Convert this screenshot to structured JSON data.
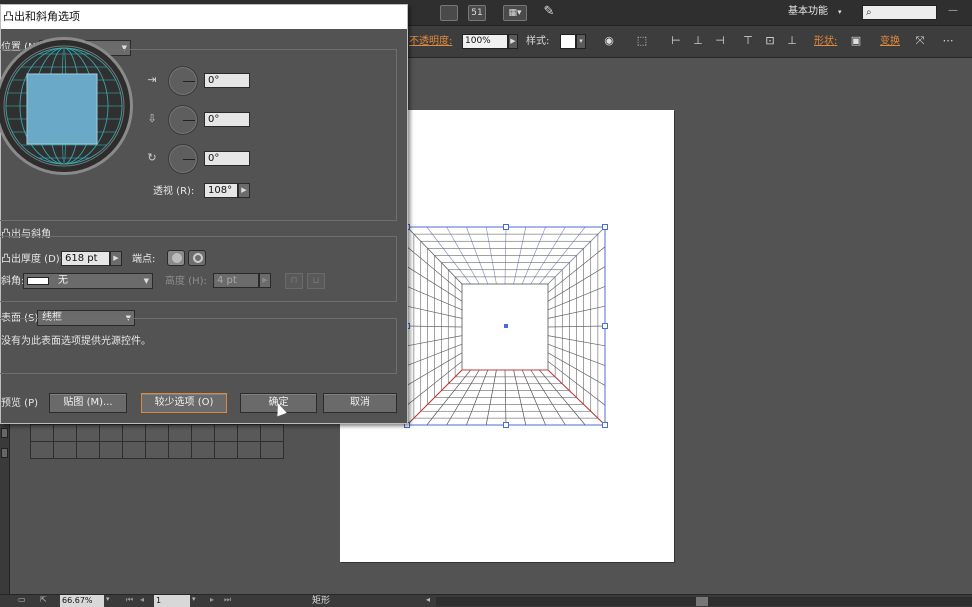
{
  "topbar": {
    "workspace_label": "基本功能",
    "search_placeholder": "",
    "icons": [
      "arrange-icon",
      "bridge-icon",
      "layout-icon",
      "gpu-icon"
    ],
    "btn_a": "",
    "btn_b": "51"
  },
  "controlbar": {
    "opacity_label": "不透明度:",
    "opacity_value": "100%",
    "style_label": "样式:",
    "shape_label": "形状:",
    "transform_label": "变换"
  },
  "dialog": {
    "title": "凸出和斜角选项",
    "position_label": "位置 (N):",
    "position_value": "前方",
    "rot_x": "0°",
    "rot_y": "0°",
    "rot_z": "0°",
    "perspective_label": "透视 (R):",
    "perspective_value": "108°",
    "extrude_section": "凸出与斜角",
    "extrude_depth_label": "凸出厚度 (D):",
    "extrude_depth_value": "618 pt",
    "cap_label": "端点:",
    "bevel_label": "斜角:",
    "bevel_value": "无",
    "height_label": "高度 (H):",
    "height_value": "4 pt",
    "surface_label": "表面 (S):",
    "surface_value": "线框",
    "surface_note": "没有为此表面选项提供光源控件。",
    "preview_label": "预览 (P)",
    "map_button": "贴图 (M)...",
    "fewer_button": "较少选项 (O)",
    "ok_button": "确定",
    "cancel_button": "取消",
    "preview_cube_color": "#6aa9c7",
    "preview_grid_color": "#3aa8b0"
  },
  "statusbar": {
    "zoom": "66.67%",
    "page": "1",
    "tool_name": "矩形"
  },
  "artwork": {
    "grid_color": "#8a94c2",
    "floor_color": "#c23b3b",
    "bounds_color": "#4a6cd4"
  }
}
